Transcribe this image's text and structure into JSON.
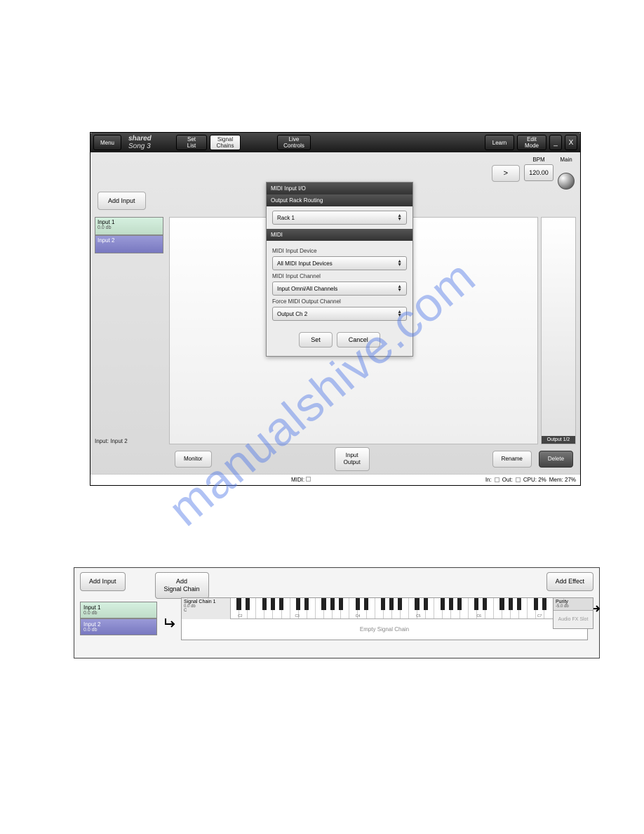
{
  "titlebar": {
    "menu": "Menu",
    "shared": "shared",
    "song": "Song 3",
    "setlist": "Set\nList",
    "signalchains": "Signal\nChains",
    "livecontrols": "Live\nControls",
    "learn": "Learn",
    "editmode": "Edit\nMode",
    "minimize": "_",
    "close": "X"
  },
  "top": {
    "play": ">",
    "bpm_label": "BPM",
    "bpm_value": "120.00",
    "main_label": "Main"
  },
  "inputs": {
    "add": "Add Input",
    "list": [
      {
        "name": "Input 1",
        "db": "0.0 db",
        "selected": false
      },
      {
        "name": "Input 2",
        "db": "",
        "selected": true
      }
    ],
    "current": "Input: Input 2"
  },
  "output": {
    "label": "Output 1/2"
  },
  "dialog": {
    "title": "MIDI Input I/O",
    "section1": "Output Rack Routing",
    "rack": "Rack 1",
    "section2": "MIDI",
    "lbl_device": "MIDI Input Device",
    "device": "All MIDI Input Devices",
    "lbl_channel": "MIDI Input Channel",
    "channel": "Input Omni/All Channels",
    "lbl_force": "Force MIDI Output Channel",
    "output": "Output Ch 2",
    "set": "Set",
    "cancel": "Cancel"
  },
  "bottom": {
    "monitor": "Monitor",
    "io": "Input\nOutput",
    "rename": "Rename",
    "delete": "Delete"
  },
  "status": {
    "midi": "MIDI:",
    "in": "In:",
    "out": "Out:",
    "cpu": "CPU: 2%",
    "mem": "Mem: 27%"
  },
  "fig2": {
    "addinput": "Add Input",
    "addchain": "Add\nSignal Chain",
    "addeffect": "Add Effect",
    "inputs": [
      {
        "name": "Input 1",
        "db": "0.0 db",
        "selected": false
      },
      {
        "name": "Input 2",
        "db": "0.0 db",
        "selected": true
      }
    ],
    "chain": {
      "name": "Signal Chain 1",
      "db": "0.0 db",
      "note": "C"
    },
    "octaves": [
      "C2",
      "C3",
      "C4",
      "C5",
      "C6",
      "C7"
    ],
    "empty": "Empty Signal Chain",
    "effect": {
      "name": "Purity",
      "db": "-5.0 db",
      "slot": "Audio FX Slot"
    }
  },
  "watermark": "manualshive.com"
}
